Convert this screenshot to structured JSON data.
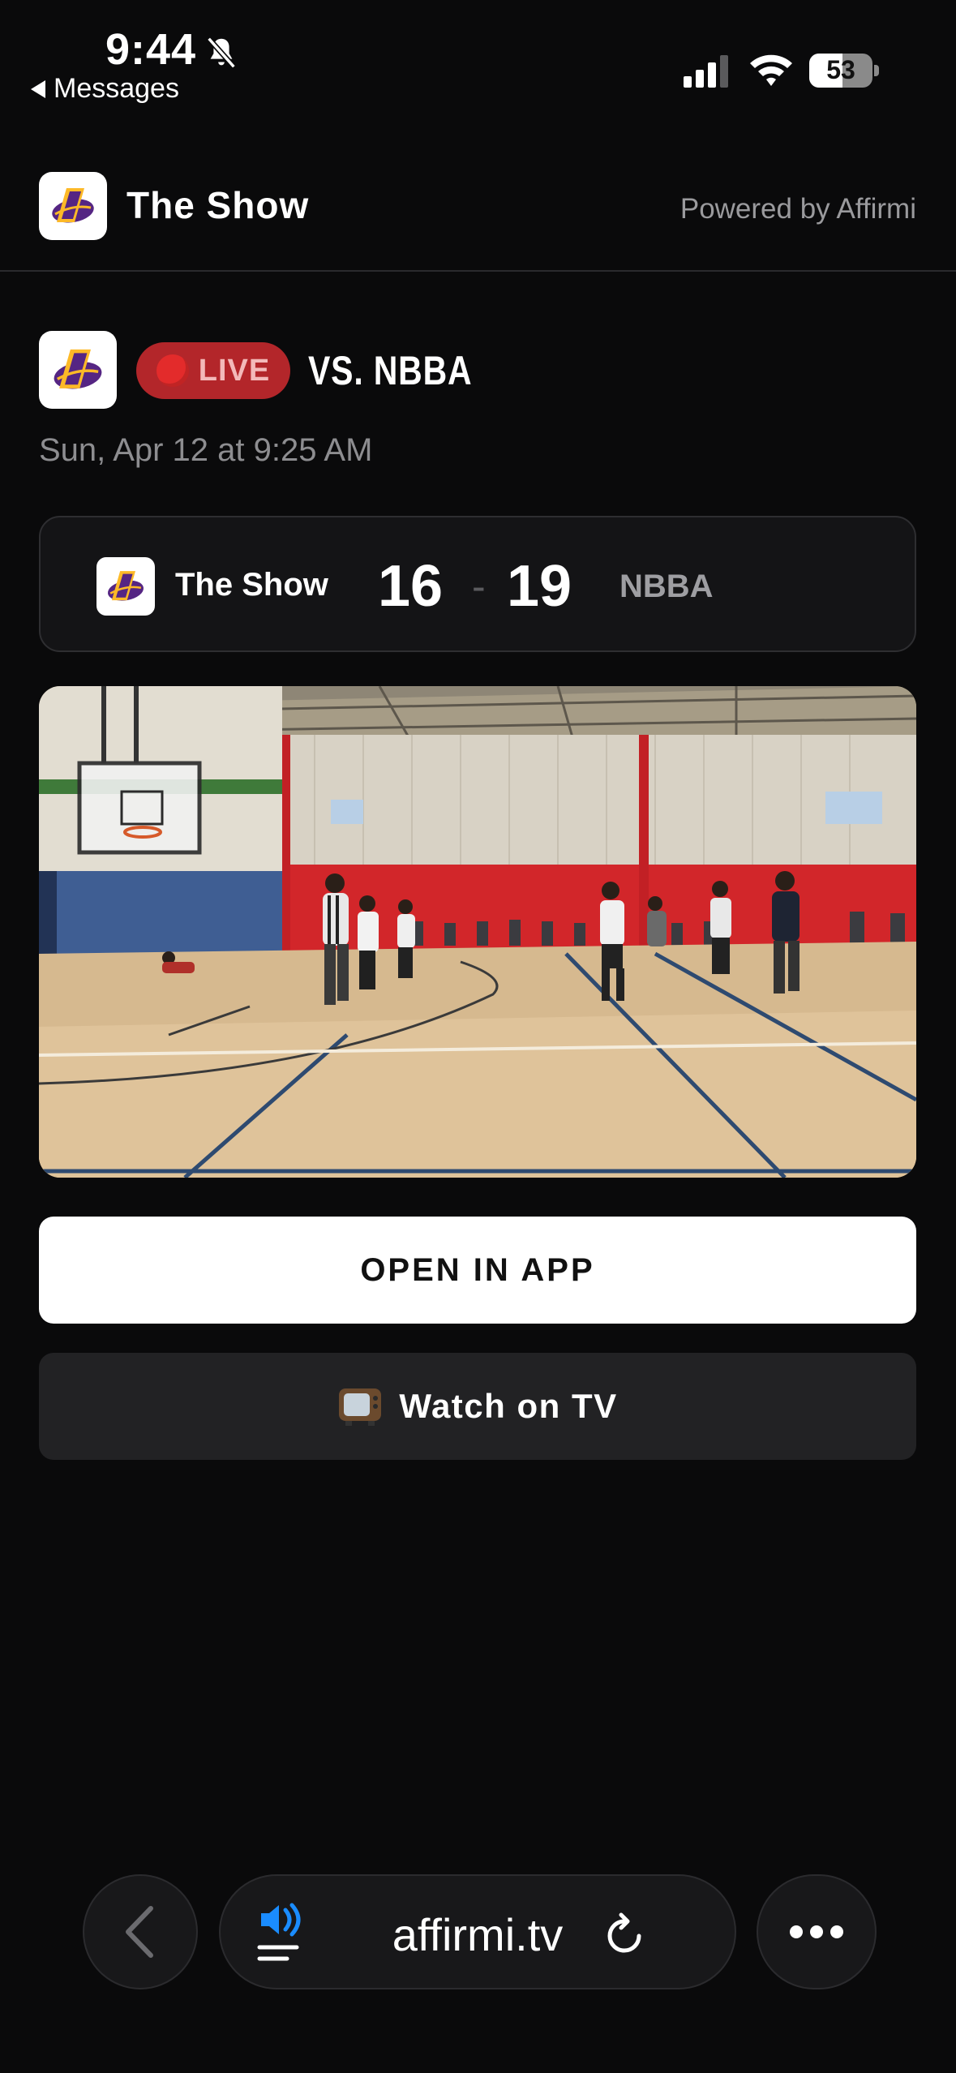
{
  "status_bar": {
    "time": "9:44",
    "back_app": "Messages",
    "battery_level": "53",
    "battery_fraction": 0.53
  },
  "header": {
    "title": "The Show",
    "powered_by": "Powered by Affirmi"
  },
  "game": {
    "live_label": "LIVE",
    "opponent": "VS. NBBA",
    "date": "Sun, Apr 12 at 9:25 AM"
  },
  "scoreboard": {
    "home_team": "The Show",
    "home_score": "16",
    "separator": "-",
    "away_score": "19",
    "away_team": "NBBA"
  },
  "actions": {
    "open_in_app": "OPEN IN APP",
    "watch_on_tv": "Watch on TV"
  },
  "browser": {
    "url": "affirmi.tv"
  },
  "colors": {
    "background": "#0a0a0b",
    "live_red": "#b3262a",
    "team_purple": "#552583",
    "team_gold": "#fdb927",
    "audio_blue": "#1a8cff"
  }
}
